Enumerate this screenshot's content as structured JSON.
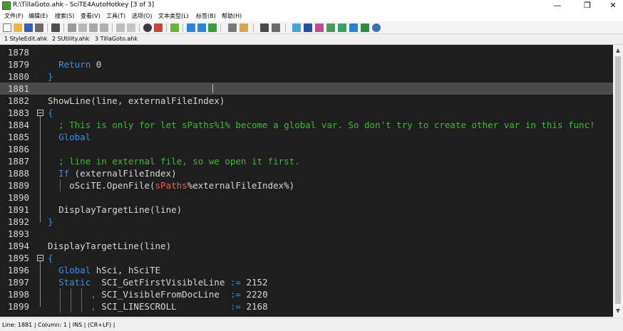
{
  "window": {
    "title": "R:\\TillaGoto.ahk - SciTE4AutoHotkey [3 of 3]",
    "minimize_glyph": "—",
    "maximize_glyph": "❐",
    "close_glyph": "✕"
  },
  "menu": [
    "文件(F)",
    "编辑(E)",
    "搜索(S)",
    "查看(V)",
    "工具(T)",
    "选项(O)",
    "文本类型(L)",
    "标签(B)",
    "帮助(H)"
  ],
  "toolbar": {
    "icons": [
      "new-file-icon",
      "open-file-icon",
      "save-icon",
      "save-all-icon",
      "print-icon",
      "cut-icon",
      "copy-icon",
      "paste-icon",
      "delete-icon",
      "undo-icon",
      "redo-icon",
      "find-icon",
      "replace-icon",
      "compile-icon",
      "run-icon",
      "step-icon",
      "debug-icon",
      "window-spy-icon",
      "settings-icon",
      "user-icon",
      "user-group-icon",
      "fullscreen-icon",
      "font-icon",
      "charset-icon",
      "style-icon",
      "tree-icon",
      "grid-icon",
      "zoom-icon"
    ]
  },
  "tabs": [
    "1 StyleEdit.ahk",
    "2 SUtility.ahk",
    "3 TillaGoto.ahk"
  ],
  "editor": {
    "current_line": 1881,
    "lines": [
      {
        "n": "1878",
        "indent": "",
        "segments": []
      },
      {
        "n": "1879",
        "indent": "  ",
        "segments": [
          [
            "kw",
            "Return"
          ],
          [
            "id",
            " 0"
          ]
        ]
      },
      {
        "n": "1880",
        "indent": "",
        "segments": [
          [
            "br",
            "}"
          ]
        ]
      },
      {
        "n": "1881",
        "indent": "",
        "segments": []
      },
      {
        "n": "1882",
        "indent": "",
        "segments": [
          [
            "id",
            "ShowLine(line, externalFileIndex)"
          ]
        ]
      },
      {
        "n": "1883",
        "indent": "",
        "segments": [
          [
            "br",
            "{"
          ]
        ]
      },
      {
        "n": "1884",
        "indent": "  ",
        "segments": [
          [
            "cmt",
            "; This is only for let sPaths%1% become a global var. So don't try to create other var in this func!"
          ]
        ]
      },
      {
        "n": "1885",
        "indent": "  ",
        "segments": [
          [
            "kw",
            "Global"
          ]
        ]
      },
      {
        "n": "1886",
        "indent": "",
        "segments": []
      },
      {
        "n": "1887",
        "indent": "  ",
        "segments": [
          [
            "cmt",
            "; line in external file, so we open it first."
          ]
        ]
      },
      {
        "n": "1888",
        "indent": "  ",
        "segments": [
          [
            "kw",
            "If"
          ],
          [
            "id",
            " (externalFileIndex)"
          ]
        ]
      },
      {
        "n": "1889",
        "indent": "    ",
        "segments": [
          [
            "id",
            "oSciTE.OpenFile("
          ],
          [
            "red",
            "sPaths"
          ],
          [
            "id",
            "%externalFileIndex%)"
          ]
        ]
      },
      {
        "n": "1890",
        "indent": "",
        "segments": []
      },
      {
        "n": "1891",
        "indent": "  ",
        "segments": [
          [
            "id",
            "DisplayTargetLine(line)"
          ]
        ]
      },
      {
        "n": "1892",
        "indent": "",
        "segments": [
          [
            "br",
            "}"
          ]
        ]
      },
      {
        "n": "1893",
        "indent": "",
        "segments": []
      },
      {
        "n": "1894",
        "indent": "",
        "segments": [
          [
            "id",
            "DisplayTargetLine(line)"
          ]
        ]
      },
      {
        "n": "1895",
        "indent": "",
        "segments": [
          [
            "br",
            "{"
          ]
        ]
      },
      {
        "n": "1896",
        "indent": "  ",
        "segments": [
          [
            "kw",
            "Global"
          ],
          [
            "id",
            " hSci, hSciTE"
          ]
        ]
      },
      {
        "n": "1897",
        "indent": "  ",
        "segments": [
          [
            "kw",
            "Static"
          ],
          [
            "id",
            "  SCI_GetFirstVisibleLine "
          ],
          [
            "op",
            ":="
          ],
          [
            "id",
            " 2152"
          ]
        ]
      },
      {
        "n": "1898",
        "indent": "        ",
        "segments": [
          [
            "op",
            ","
          ],
          [
            "id",
            " SCI_VisibleFromDocLine  "
          ],
          [
            "op",
            ":="
          ],
          [
            "id",
            " 2220"
          ]
        ]
      },
      {
        "n": "1899",
        "indent": "        ",
        "segments": [
          [
            "op",
            ","
          ],
          [
            "id",
            " SCI_LINESCROLL          "
          ],
          [
            "op",
            ":="
          ],
          [
            "id",
            " 2168"
          ]
        ]
      }
    ]
  },
  "status": {
    "text": "Line: 1881 | Column: 1 | INS | (CR+LF) |"
  }
}
